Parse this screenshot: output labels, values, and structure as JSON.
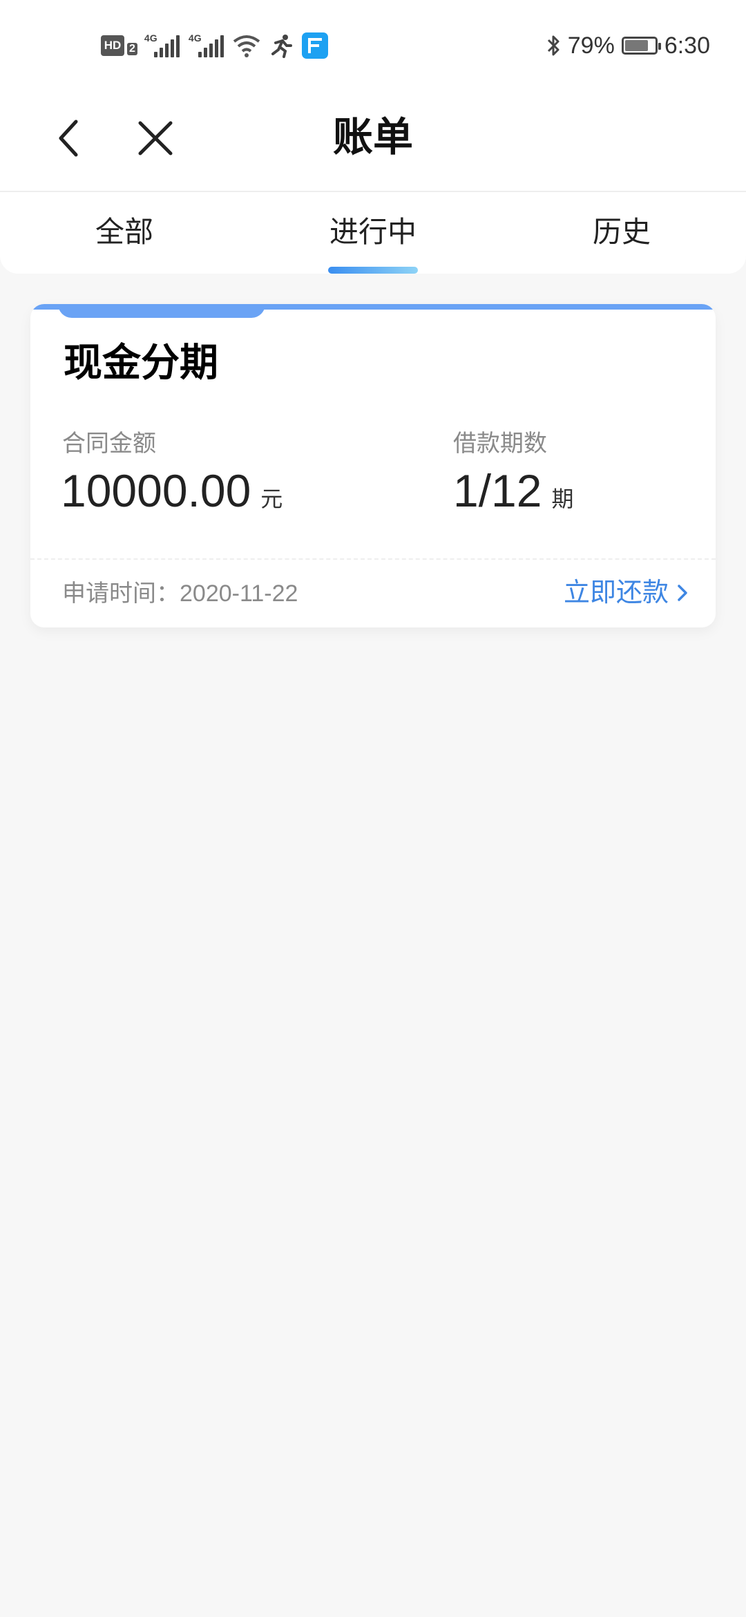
{
  "status_bar": {
    "hd_label": "HD",
    "hd_sub": "2",
    "sim1_network": "4G",
    "sim2_network": "4G",
    "battery_percent": "79%",
    "battery_level": 0.79,
    "time": "6:30",
    "icons": [
      "hd-icon",
      "signal-icon",
      "signal-icon",
      "wifi-icon",
      "running-icon",
      "app-notification-icon",
      "bluetooth-icon",
      "battery-icon"
    ]
  },
  "header": {
    "title": "账单",
    "back_icon": "chevron-left-icon",
    "close_icon": "close-icon"
  },
  "tabs": [
    {
      "label": "全部",
      "active": false
    },
    {
      "label": "进行中",
      "active": true
    },
    {
      "label": "历史",
      "active": false
    }
  ],
  "bill_card": {
    "title": "现金分期",
    "amount_label": "合同金额",
    "amount_value": "10000.00",
    "amount_unit": "元",
    "term_label": "借款期数",
    "term_value": "1/12",
    "term_unit": "期",
    "apply_date": "申请时间：2020-11-22",
    "repay_label": "立即还款",
    "accent_color": "#6aa3f5",
    "link_color": "#3e86e3"
  }
}
